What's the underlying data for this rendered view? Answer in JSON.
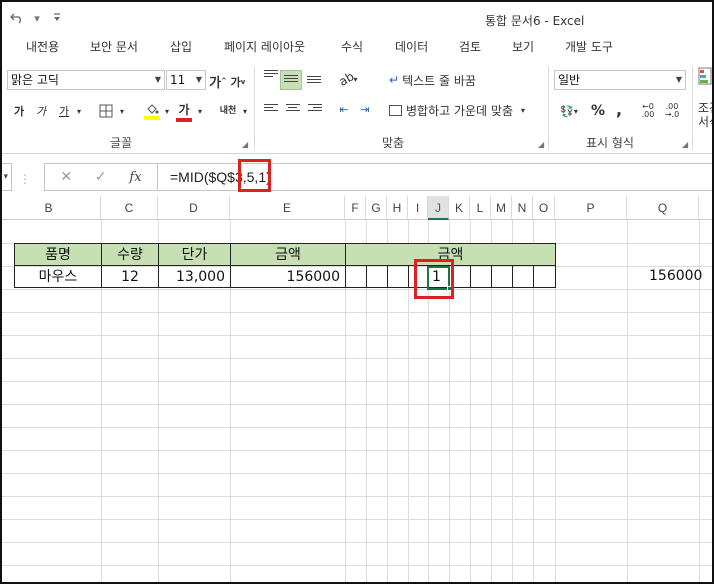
{
  "title": {
    "document": "통합 문서6 - Excel"
  },
  "ribbon_tabs": [
    "내전용",
    "보안 문서",
    "삽입",
    "페이지 레이아웃",
    "수식",
    "데이터",
    "검토",
    "보기",
    "개발 도구"
  ],
  "font_group": {
    "font_name": "맑은 고딕",
    "font_size": "11",
    "grow_label": "가",
    "shrink_label": "가",
    "bold_label": "가",
    "italic_label": "가",
    "underline_label": "가",
    "font_color_label": "가",
    "phonetic_label": "내천",
    "label": "글꼴",
    "font_color": "#e02020",
    "fill_color": "#ffff00"
  },
  "alignment_group": {
    "wrap_text_label": "텍스트 줄 바꿈",
    "merge_center_label": "병합하고 가운데 맞춤",
    "label": "맞춤"
  },
  "number_group": {
    "format_value": "일반",
    "percent_label": "%",
    "comma_label": ",",
    "label": "표시 형식",
    "cut_label_1": "조건",
    "cut_label_2": "서식"
  },
  "formula_bar": {
    "fx_label": "fx",
    "cancel_label": "✕",
    "enter_label": "✓",
    "formula": "=MID($Q$3,5,1)"
  },
  "columns": [
    "B",
    "C",
    "D",
    "E",
    "F",
    "G",
    "H",
    "I",
    "J",
    "K",
    "L",
    "M",
    "N",
    "O",
    "P",
    "Q"
  ],
  "active_column": "J",
  "table": {
    "headers": [
      "품명",
      "수량",
      "단가",
      "금액",
      "금액"
    ],
    "row": {
      "item": "마우스",
      "qty": "12",
      "price": "13,000",
      "amount": "156000",
      "digit_j": "1"
    }
  },
  "q_value": "156000",
  "accent_color": "#217346",
  "header_fill": "#c6e0b4",
  "highlight_color": "#e02020"
}
